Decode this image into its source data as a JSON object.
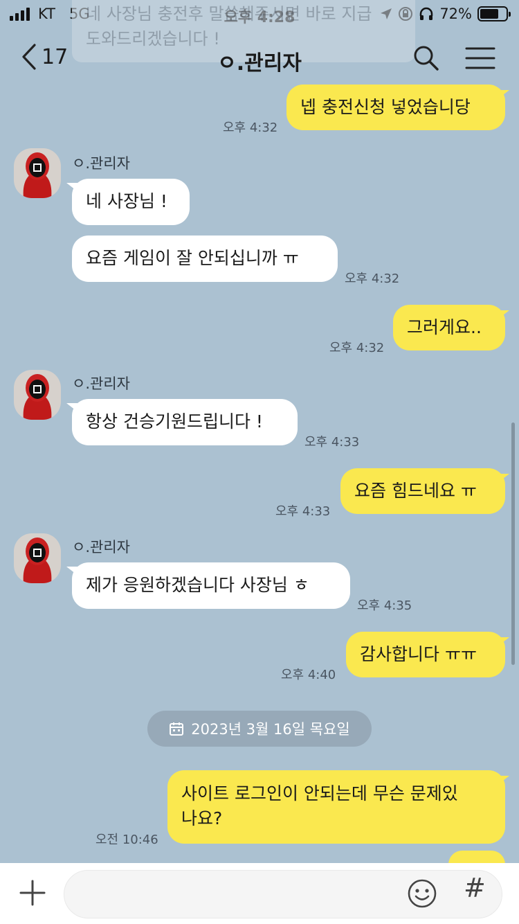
{
  "status_bar": {
    "carrier": "KT",
    "network": "5G",
    "time": "오후 4:28",
    "battery": "72%",
    "battery_level": 0.72
  },
  "notice": {
    "line1": "네 사장님 충전후 말씀해주시면 바로 지급",
    "line2": "도와드리겠습니다 !"
  },
  "header": {
    "back_count": "17",
    "title": "ㅇ.관리자"
  },
  "messages": [
    {
      "from": "me",
      "text": "넵 충전신청 넣었습니당",
      "time": "오후 4:32"
    },
    {
      "from": "them",
      "sender": "ㅇ.관리자",
      "text": "네 사장님 !"
    },
    {
      "from": "them",
      "text": "요즘 게임이 잘 안되십니까 ㅠ",
      "time": "오후 4:32"
    },
    {
      "from": "me",
      "text": "그러게요..",
      "time": "오후 4:32"
    },
    {
      "from": "them",
      "sender": "ㅇ.관리자",
      "text": "항상 건승기원드립니다 !",
      "time": "오후 4:33"
    },
    {
      "from": "me",
      "text": "요즘 힘드네요 ㅠ",
      "time": "오후 4:33"
    },
    {
      "from": "them",
      "sender": "ㅇ.관리자",
      "text": "제가 응원하겠습니다 사장님 ㅎ",
      "time": "오후 4:35"
    },
    {
      "from": "me",
      "text": "감사합니다 ㅠㅠ",
      "time": "오후 4:40"
    },
    {
      "from": "me",
      "text_line1": "사이트 로그인이 안되는데 무슨 문제있",
      "text_line2": "나요?",
      "time": "오전 10:46"
    }
  ],
  "date_divider": "2023년 3월 16일 목요일",
  "input": {
    "placeholder": "",
    "hash_label": "#"
  },
  "colors": {
    "background": "#abc1d1",
    "my_bubble": "#fae84f",
    "their_bubble": "#ffffff"
  }
}
